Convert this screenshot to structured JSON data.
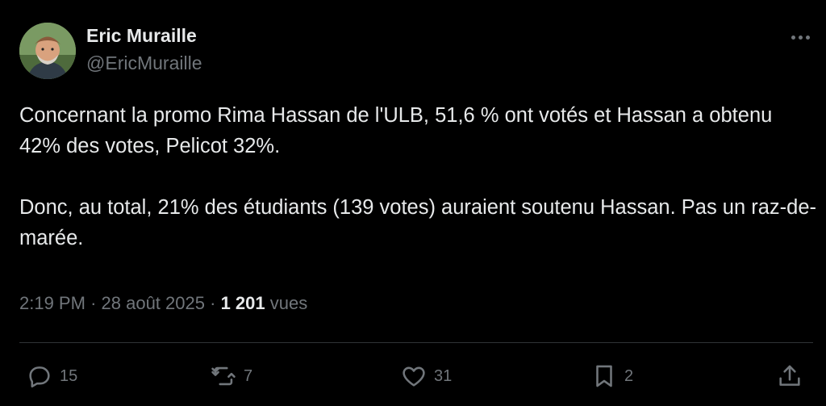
{
  "author": {
    "display_name": "Eric Muraille",
    "handle": "@EricMuraille"
  },
  "tweet": {
    "paragraphs": [
      "Concernant la promo Rima Hassan de l'ULB, 51,6 % ont votés et Hassan a obtenu 42% des votes, Pelicot 32%.",
      "Donc, au total, 21% des étudiants (139 votes) auraient soutenu Hassan. Pas un raz-de-marée."
    ],
    "time": "2:19 PM",
    "separator": "·",
    "date": "28 août 2025",
    "views_count": "1 201",
    "views_label": "vues"
  },
  "actions": {
    "reply_count": "15",
    "retweet_count": "7",
    "like_count": "31",
    "bookmark_count": "2"
  },
  "icons": {
    "more": "more-horizontal-icon",
    "reply": "reply-icon",
    "retweet": "retweet-icon",
    "like": "heart-icon",
    "bookmark": "bookmark-icon",
    "share": "share-icon"
  },
  "colors": {
    "background": "#000000",
    "text": "#e7e9ea",
    "secondary_text": "#71767b",
    "divider": "#2f3336"
  }
}
